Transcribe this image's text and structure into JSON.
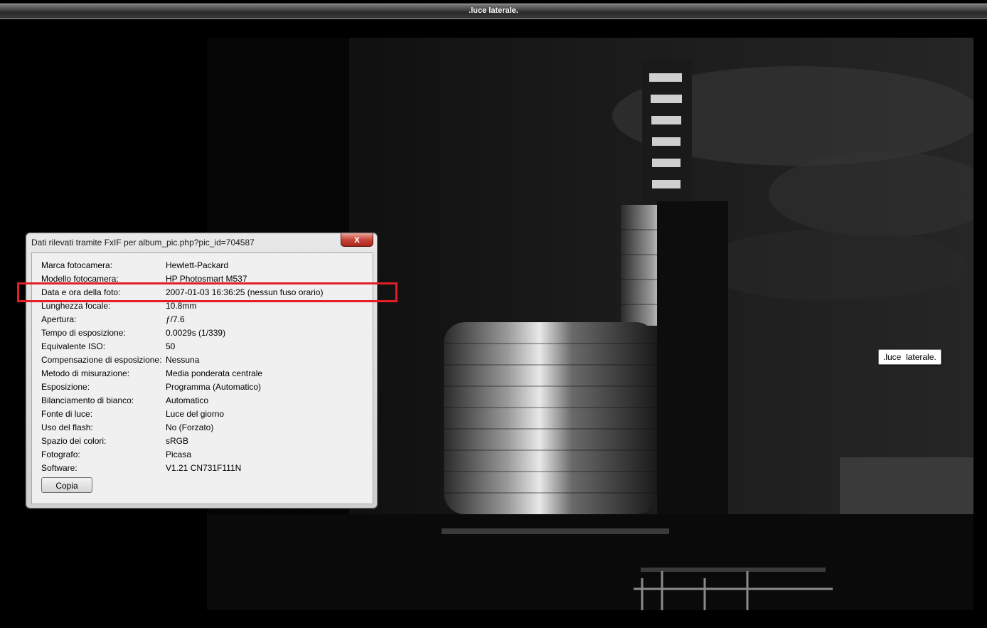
{
  "window": {
    "title": ".luce laterale."
  },
  "tooltip": {
    "text": ".luce  laterale."
  },
  "dialog": {
    "title": "Dati rilevati tramite FxIF per album_pic.php?pic_id=704587",
    "close_label": "x",
    "rows": [
      {
        "label": "Marca fotocamera:",
        "value": "Hewlett-Packard"
      },
      {
        "label": "Modello fotocamera:",
        "value": "HP Photosmart M537"
      },
      {
        "label": "Data e ora della foto:",
        "value": "2007-01-03 16:36:25 (nessun fuso orario)"
      },
      {
        "label": "Lunghezza focale:",
        "value": "10.8mm"
      },
      {
        "label": "Apertura:",
        "value": "ƒ/7.6"
      },
      {
        "label": "Tempo di esposizione:",
        "value": "0.0029s (1/339)"
      },
      {
        "label": "Equivalente ISO:",
        "value": "50"
      },
      {
        "label": "Compensazione di esposizione:",
        "value": "Nessuna"
      },
      {
        "label": "Metodo di misurazione:",
        "value": "Media ponderata centrale"
      },
      {
        "label": "Esposizione:",
        "value": "Programma (Automatico)"
      },
      {
        "label": "Bilanciamento di bianco:",
        "value": "Automatico"
      },
      {
        "label": "Fonte di luce:",
        "value": "Luce del giorno"
      },
      {
        "label": "Uso del flash:",
        "value": "No (Forzato)"
      },
      {
        "label": "Spazio dei colori:",
        "value": "sRGB"
      },
      {
        "label": "Fotografo:",
        "value": "Picasa"
      },
      {
        "label": "Software:",
        "value": "V1.21 CN731F111N"
      }
    ],
    "copy_label": "Copia"
  },
  "colors": {
    "highlight": "#e41e26",
    "close_button": "#c8463a"
  }
}
